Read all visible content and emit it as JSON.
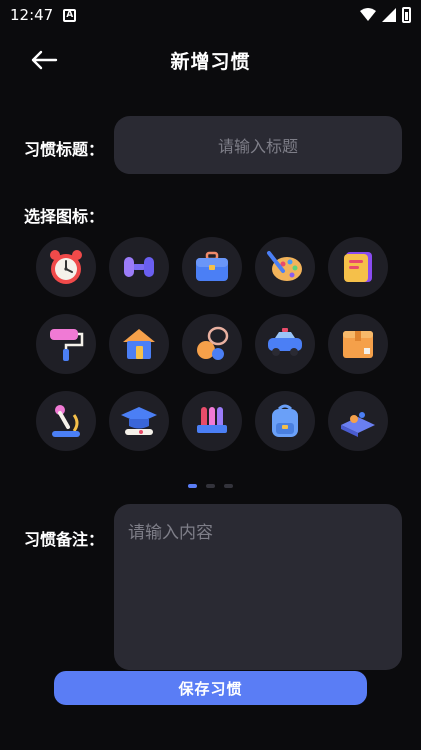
{
  "status_bar": {
    "time": "12:47",
    "notification_icon": "A"
  },
  "header": {
    "title": "新增习惯",
    "back_icon": "arrow-left-icon"
  },
  "title_field": {
    "label": "习惯标题：",
    "placeholder": "请输入标题"
  },
  "icon_section": {
    "label": "选择图标：",
    "icons": [
      "alarm-clock-icon",
      "dumbbell-icon",
      "briefcase-icon",
      "paint-palette-icon",
      "notebook-icon",
      "paint-roller-icon",
      "house-icon",
      "sports-balls-icon",
      "car-icon",
      "package-box-icon",
      "microscope-icon",
      "graduation-cap-icon",
      "test-tubes-icon",
      "backpack-icon",
      "sandbox-toy-icon"
    ],
    "page_count": 3,
    "active_page": 1
  },
  "note_field": {
    "label": "习惯备注：",
    "placeholder": "请输入内容"
  },
  "save_button": {
    "label": "保存习惯"
  },
  "colors": {
    "background": "#0b0b0d",
    "field": "#2a2a33",
    "accent": "#5a7df5",
    "icon_bg": "#1f1f26"
  }
}
